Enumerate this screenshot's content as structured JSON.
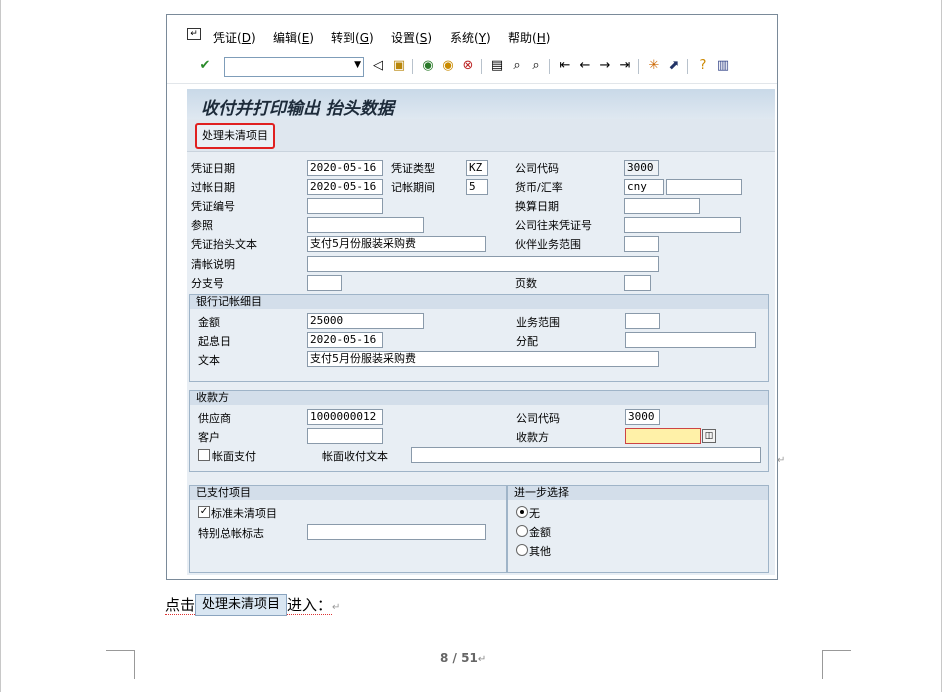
{
  "menu": {
    "items": [
      {
        "label": "凭证(",
        "key": "D"
      },
      {
        "label": "编辑(",
        "key": "E"
      },
      {
        "label": "转到(",
        "key": "G"
      },
      {
        "label": "设置(",
        "key": "S"
      },
      {
        "label": "系统(",
        "key": "Y"
      },
      {
        "label": "帮助(",
        "key": "H"
      }
    ],
    "close_paren": ")"
  },
  "toolbar": {
    "command_value": "",
    "icons": [
      "enter-icon",
      "back-arrow-icon",
      "save-icon",
      "back-icon",
      "exit-icon",
      "cancel-icon",
      "print-icon",
      "find-icon",
      "find-next-icon",
      "first-page-icon",
      "prev-page-icon",
      "next-page-icon",
      "last-page-icon",
      "new-session-icon",
      "shortcut-icon",
      "help-icon",
      "layout-icon"
    ]
  },
  "screen": {
    "title": "收付并打印输出 抬头数据",
    "process_open_items_label": "处理未清项目"
  },
  "header": {
    "doc_date_label": "凭证日期",
    "doc_date": "2020-05-16",
    "doc_type_label": "凭证类型",
    "doc_type": "KZ",
    "company_code_label": "公司代码",
    "company_code": "3000",
    "posting_date_label": "过帐日期",
    "posting_date": "2020-05-16",
    "period_label": "记帐期间",
    "period": "5",
    "currency_label": "货币/汇率",
    "currency": "cny",
    "rate": "",
    "doc_number_label": "凭证编号",
    "doc_number": "",
    "translation_date_label": "换算日期",
    "translation_date": "",
    "reference_label": "参照",
    "reference": "",
    "cc_doc_number_label": "公司往来凭证号",
    "cc_doc_number": "",
    "header_text_label": "凭证抬头文本",
    "header_text": "支付5月份服装采购费",
    "trading_partner_label": "伙伴业务范围",
    "trading_partner": "",
    "clearing_text_label": "清帐说明",
    "clearing_text": "",
    "branch_label": "分支号",
    "branch": "",
    "pages_label": "页数",
    "pages": ""
  },
  "bank": {
    "title": "银行记帐细目",
    "amount_label": "金额",
    "amount": "25000",
    "business_area_label": "业务范围",
    "business_area": "",
    "value_date_label": "起息日",
    "value_date": "2020-05-16",
    "assignment_label": "分配",
    "assignment": "",
    "text_label": "文本",
    "text": "支付5月份服装采购费"
  },
  "payee": {
    "title": "收款方",
    "vendor_label": "供应商",
    "vendor": "1000000012",
    "company_code_label": "公司代码",
    "company_code": "3000",
    "customer_label": "客户",
    "customer": "",
    "payee_label": "收款方",
    "payee": "",
    "pmnt_on_acct_label": "帐面支付",
    "pmnt_text_label": "帐面收付文本",
    "pmnt_text": ""
  },
  "paid_items": {
    "title": "已支付项目",
    "standard_oi_label": "标准未清项目",
    "standard_oi_checked": true,
    "special_gl_label": "特别总帐标志",
    "special_gl": ""
  },
  "further_selection": {
    "title": "进一步选择",
    "options": [
      "无",
      "金额",
      "其他"
    ],
    "selected": "无"
  },
  "document": {
    "text_before": "点击",
    "button_label": "处理未清项目",
    "text_after": "进入：",
    "page_current": "8",
    "page_sep": " / ",
    "page_total": "51"
  }
}
